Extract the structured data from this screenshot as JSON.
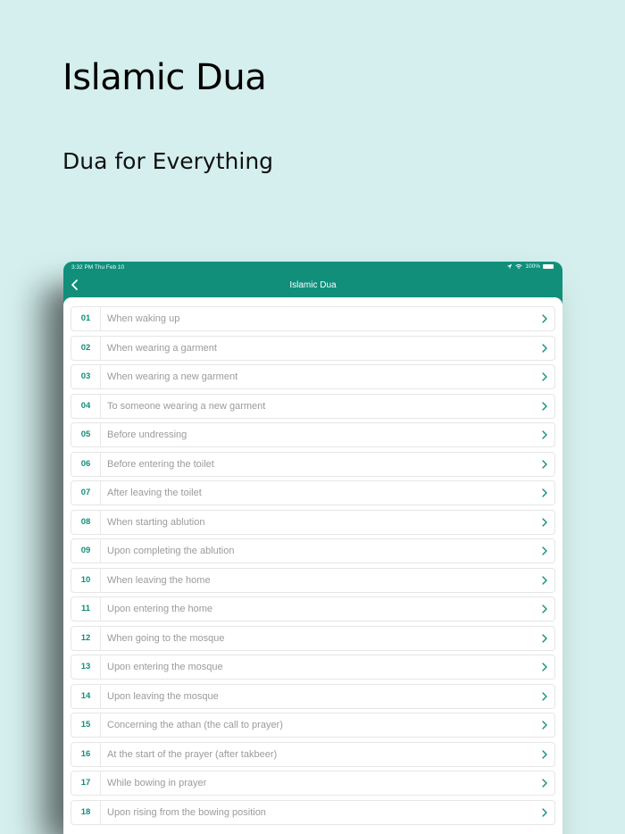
{
  "promo": {
    "headline": "Islamic Dua",
    "subline": "Dua for Everything"
  },
  "status_bar": {
    "time": "3:32 PM  Thu Feb 10",
    "battery": "100%"
  },
  "nav": {
    "title": "Islamic Dua"
  },
  "colors": {
    "accent": "#118f7b",
    "background": "#d4efed"
  },
  "duas": [
    {
      "num": "01",
      "title": "When waking up"
    },
    {
      "num": "02",
      "title": "When wearing a garment"
    },
    {
      "num": "03",
      "title": "When wearing a new garment"
    },
    {
      "num": "04",
      "title": "To someone wearing a new garment"
    },
    {
      "num": "05",
      "title": "Before undressing"
    },
    {
      "num": "06",
      "title": "Before entering the toilet"
    },
    {
      "num": "07",
      "title": "After leaving the toilet"
    },
    {
      "num": "08",
      "title": "When starting ablution"
    },
    {
      "num": "09",
      "title": "Upon completing the ablution"
    },
    {
      "num": "10",
      "title": "When leaving the home"
    },
    {
      "num": "11",
      "title": "Upon entering the home"
    },
    {
      "num": "12",
      "title": "When going to the mosque"
    },
    {
      "num": "13",
      "title": "Upon entering the mosque"
    },
    {
      "num": "14",
      "title": "Upon leaving the mosque"
    },
    {
      "num": "15",
      "title": "Concerning the athan (the call to prayer)"
    },
    {
      "num": "16",
      "title": "At the start of the prayer (after takbeer)"
    },
    {
      "num": "17",
      "title": "While bowing in prayer"
    },
    {
      "num": "18",
      "title": "Upon rising from the bowing position"
    }
  ]
}
